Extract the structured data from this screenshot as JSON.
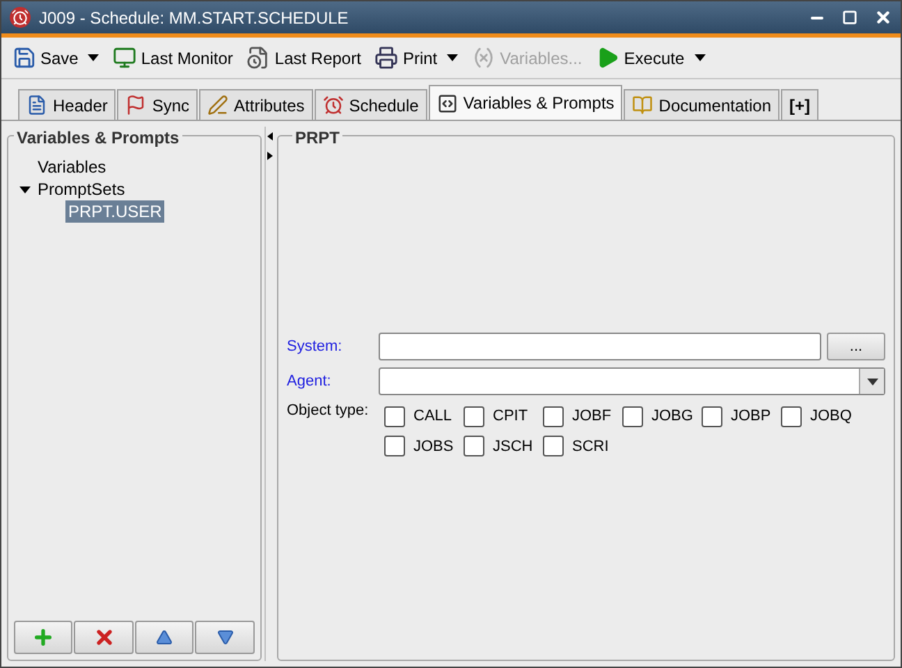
{
  "window": {
    "title": "J009 - Schedule: MM.START.SCHEDULE"
  },
  "toolbar": [
    {
      "kind": "save",
      "label": "Save",
      "dropdown": true,
      "disabled": false
    },
    {
      "kind": "monitor",
      "label": "Last Monitor",
      "dropdown": false,
      "disabled": false
    },
    {
      "kind": "report",
      "label": "Last Report",
      "dropdown": false,
      "disabled": false
    },
    {
      "kind": "print",
      "label": "Print",
      "dropdown": true,
      "disabled": false
    },
    {
      "kind": "variables",
      "label": "Variables...",
      "dropdown": false,
      "disabled": true
    },
    {
      "kind": "execute",
      "label": "Execute",
      "dropdown": true,
      "disabled": false
    }
  ],
  "tabs": [
    {
      "kind": "header",
      "label": "Header",
      "selected": false
    },
    {
      "kind": "sync",
      "label": "Sync",
      "selected": false
    },
    {
      "kind": "attributes",
      "label": "Attributes",
      "selected": false
    },
    {
      "kind": "schedule",
      "label": "Schedule",
      "selected": false
    },
    {
      "kind": "variables",
      "label": "Variables & Prompts",
      "selected": true
    },
    {
      "kind": "documentation",
      "label": "Documentation",
      "selected": false
    },
    {
      "kind": "add",
      "label": "[+]",
      "selected": false
    }
  ],
  "left_panel": {
    "title": "Variables & Prompts",
    "tree": [
      {
        "label": "Variables",
        "selected": false
      },
      {
        "label": "PromptSets",
        "selected": false,
        "expanded": true,
        "children": [
          {
            "label": "PRPT.USER",
            "selected": true
          }
        ]
      }
    ]
  },
  "right_panel": {
    "title": "PRPT",
    "system": {
      "label": "System:",
      "browse": "..."
    },
    "agent": {
      "label": "Agent:"
    },
    "object_type": {
      "label": "Object type:",
      "options": [
        {
          "label": "CALL",
          "checked": false
        },
        {
          "label": "CPIT",
          "checked": false
        },
        {
          "label": "JOBF",
          "checked": false
        },
        {
          "label": "JOBG",
          "checked": false
        },
        {
          "label": "JOBP",
          "checked": false
        },
        {
          "label": "JOBQ",
          "checked": false
        },
        {
          "label": "JOBS",
          "checked": false
        },
        {
          "label": "JSCH",
          "checked": false
        },
        {
          "label": "SCRI",
          "checked": false
        }
      ]
    }
  }
}
